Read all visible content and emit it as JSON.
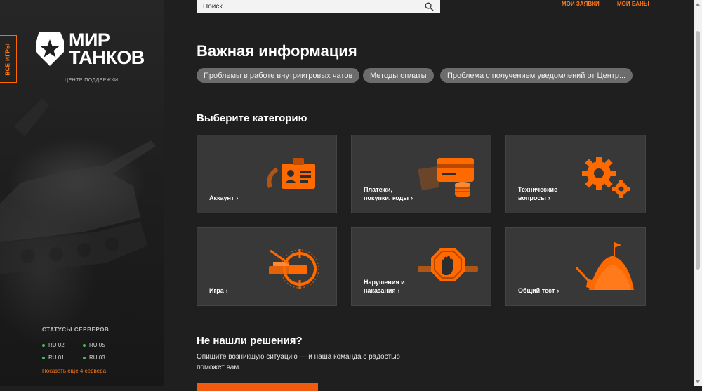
{
  "sidebar": {
    "all_games_label": "ВСЕ ИГРЫ",
    "logo_line1": "МИР",
    "logo_line2": "ТАНКОВ",
    "support_center": "ЦЕНТР ПОДДЕРЖКИ",
    "servers_title": "СТАТУСЫ СЕРВЕРОВ",
    "servers": [
      {
        "name": "RU 02",
        "status_color": "#3fbf4f"
      },
      {
        "name": "RU 05",
        "status_color": "#3fbf4f"
      },
      {
        "name": "RU 01",
        "status_color": "#3fbf4f"
      },
      {
        "name": "RU 03",
        "status_color": "#3fbf4f"
      }
    ],
    "show_more_servers": "Показать ещё 4 сервера"
  },
  "header": {
    "search_placeholder": "Поиск",
    "my_requests": "МОИ ЗАЯВКИ",
    "my_bans": "МОИ БАНЫ"
  },
  "important": {
    "title": "Важная информация",
    "pills": [
      "Проблемы в работе внутриигровых чатов",
      "Методы оплаты",
      "Проблема с получением уведомлений от Центр..."
    ]
  },
  "categories": {
    "title": "Выберите категорию",
    "items": [
      {
        "line1": "Аккаунт",
        "line2": "",
        "icon": "id-card-icon"
      },
      {
        "line1": "Платежи,",
        "line2": "покупки, коды",
        "icon": "payment-card-coins-icon"
      },
      {
        "line1": "Технические",
        "line2": "вопросы",
        "icon": "gears-icon"
      },
      {
        "line1": "Игра",
        "line2": "",
        "icon": "tank-crosshair-icon"
      },
      {
        "line1": "Нарушения и",
        "line2": "наказания",
        "icon": "stop-hand-icon"
      },
      {
        "line1": "Общий тест",
        "line2": "",
        "icon": "sand-shovel-flag-icon"
      }
    ]
  },
  "no_solution": {
    "title": "Не нашли решения?",
    "text": "Опишите возникшую ситуацию — и наша команда с радостью поможет вам."
  },
  "colors": {
    "accent": "#ff6a00",
    "server_ok": "#3fbf4f",
    "card_bg": "#383838",
    "page_bg": "#1f1f1f"
  }
}
